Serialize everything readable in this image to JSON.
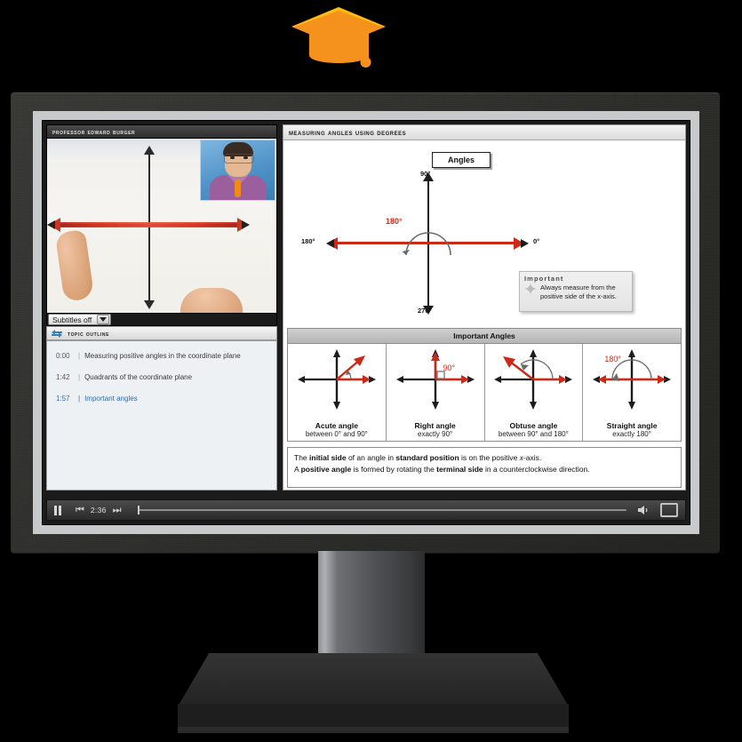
{
  "logo": {
    "name": "graduation-cap-logo",
    "color": "#F5921E"
  },
  "player": {
    "video": {
      "title": "Professor Edward Burger",
      "pip_label": "professor-video-thumbnail"
    },
    "subtitles": {
      "value": "Subtitles off",
      "dropdown_icon": "chevron-down-icon"
    },
    "outline": {
      "title": "Topic Outline",
      "icon": "topic-outline-icon",
      "items": [
        {
          "time": "0:00",
          "label": "Measuring positive angles in the coordinate plane",
          "active": false
        },
        {
          "time": "1:42",
          "label": "Quadrants of the coordinate plane",
          "active": false
        },
        {
          "time": "1:57",
          "label": "Important angles",
          "active": true
        }
      ]
    },
    "controls": {
      "pause_label": "Pause",
      "prev_label": "Previous",
      "next_label": "Next",
      "time": "2:36",
      "volume_label": "Volume",
      "fullscreen_label": "Full screen"
    }
  },
  "slide": {
    "title": "Measuring Angles Using Degrees",
    "chip": "Angles",
    "plane": {
      "top": "90°",
      "left": "180°",
      "right": "0°",
      "bottom": "270°",
      "arc_label": "180°"
    },
    "tip": {
      "heading": "Important",
      "body": "Always measure from the positive side of the x-axis.",
      "icon": "star-icon"
    },
    "table": {
      "title": "Important Angles",
      "cells": [
        {
          "name": "Acute angle",
          "desc": "between 0° and 90°",
          "mark": ""
        },
        {
          "name": "Right angle",
          "desc": "exactly 90°",
          "mark": "90°"
        },
        {
          "name": "Obtuse angle",
          "desc": "between 90° and 180°",
          "mark": ""
        },
        {
          "name": "Straight angle",
          "desc": "exactly 180°",
          "mark": "180°"
        }
      ]
    },
    "footnote_line1_a": "The ",
    "footnote_line1_b": "initial side",
    "footnote_line1_c": " of an angle in ",
    "footnote_line1_d": "standard position",
    "footnote_line1_e": " is on the positive ",
    "footnote_line1_f": "x",
    "footnote_line1_g": "-axis.",
    "footnote_line2_a": "A ",
    "footnote_line2_b": "positive angle",
    "footnote_line2_c": " is formed by rotating the ",
    "footnote_line2_d": "terminal side",
    "footnote_line2_e": " in a counterclockwise direction."
  }
}
